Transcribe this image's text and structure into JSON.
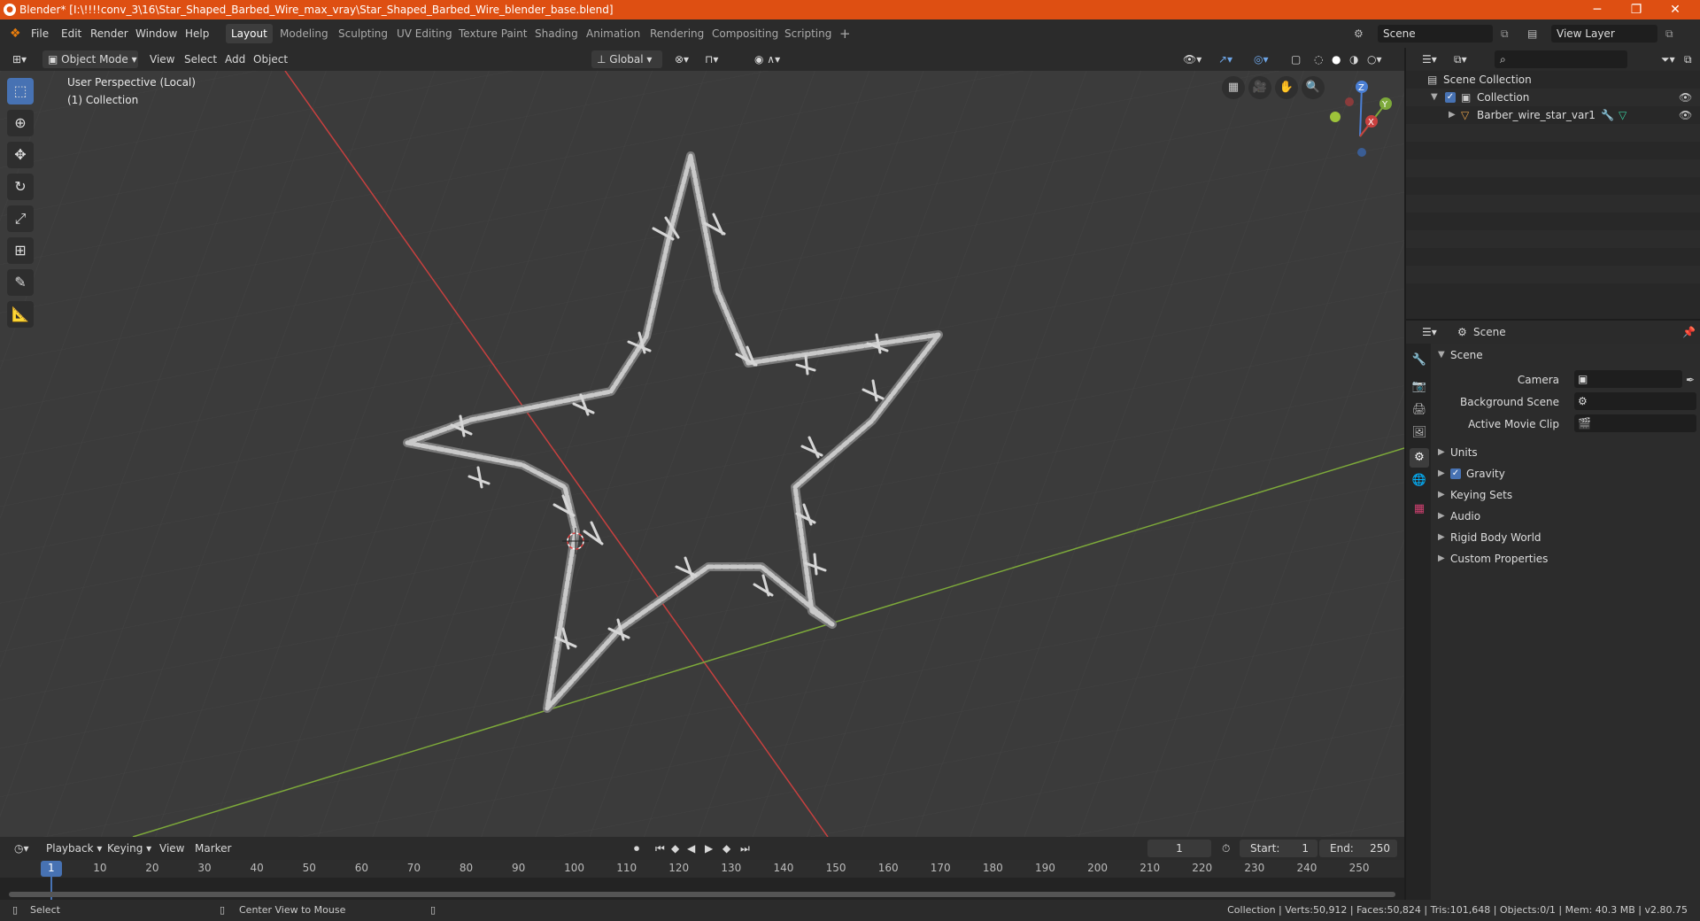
{
  "titlebar": {
    "title": "Blender* [I:\\!!!!conv_3\\16\\Star_Shaped_Barbed_Wire_max_vray\\Star_Shaped_Barbed_Wire_blender_base.blend]",
    "minimize": "─",
    "maximize": "❐",
    "close": "✕"
  },
  "menu": [
    "File",
    "Edit",
    "Render",
    "Window",
    "Help"
  ],
  "workspaces": [
    "Layout",
    "Modeling",
    "Sculpting",
    "UV Editing",
    "Texture Paint",
    "Shading",
    "Animation",
    "Rendering",
    "Compositing",
    "Scripting"
  ],
  "workspace_add": "+",
  "scene_field": "Scene",
  "view_layer_field": "View Layer",
  "viewport_header": {
    "mode": "Object Mode",
    "view": "View",
    "select": "Select",
    "add": "Add",
    "object": "Object",
    "orientation": "Global"
  },
  "viewport": {
    "perspective": "User Perspective (Local)",
    "collection": "(1) Collection",
    "gizmo": {
      "x": "X",
      "y": "Y",
      "z": "Z"
    }
  },
  "outliner": {
    "scene_collection": "Scene Collection",
    "collection": "Collection",
    "object": "Barber_wire_star_var1"
  },
  "properties": {
    "header_title": "Scene",
    "panel": "Scene",
    "camera_label": "Camera",
    "background_label": "Background Scene",
    "movieclip_label": "Active Movie Clip",
    "sections": [
      "Units",
      "Gravity",
      "Keying Sets",
      "Audio",
      "Rigid Body World",
      "Custom Properties"
    ]
  },
  "timeline": {
    "playback": "Playback",
    "keying": "Keying",
    "view": "View",
    "marker": "Marker",
    "current_frame": "1",
    "start_label": "Start:",
    "start": "1",
    "end_label": "End:",
    "end": "250",
    "ticks": [
      "1",
      "10",
      "20",
      "30",
      "40",
      "50",
      "60",
      "70",
      "80",
      "90",
      "100",
      "110",
      "120",
      "130",
      "140",
      "150",
      "160",
      "170",
      "180",
      "190",
      "200",
      "210",
      "220",
      "230",
      "240",
      "250"
    ]
  },
  "statusbar": {
    "select": "Select",
    "center": "Center View to Mouse",
    "stats": "Collection | Verts:50,912 | Faces:50,824 | Tris:101,648 | Objects:0/1 | Mem: 40.3 MB | v2.80.75"
  },
  "colors": {
    "titlebar": "#de4f12",
    "accent": "#4772b3",
    "x_axis": "#c8403f",
    "y_axis": "#7da93a",
    "wire": "#c9c9c9"
  }
}
